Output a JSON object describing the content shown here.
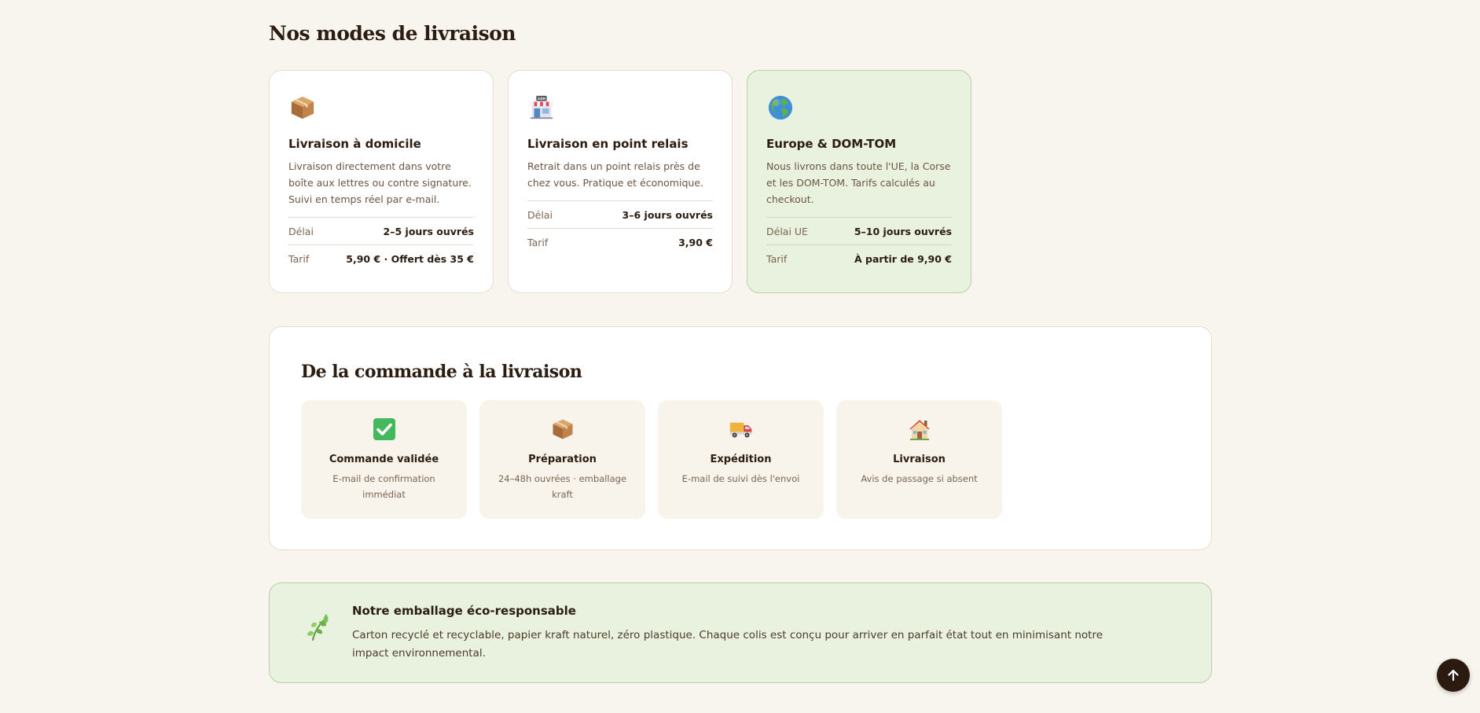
{
  "shipping": {
    "title": "Nos modes de livraison",
    "cards": [
      {
        "icon": "package-icon",
        "title": "Livraison à domicile",
        "description": "Livraison directement dans votre boîte aux lettres ou contre signature. Suivi en temps réel par e-mail.",
        "rows": [
          {
            "label": "Délai",
            "value": "2–5 jours ouvrés"
          },
          {
            "label": "Tarif",
            "value": "5,90 € · Offert dès 35 €"
          }
        ]
      },
      {
        "icon": "store-24h-icon",
        "title": "Livraison en point relais",
        "description": "Retrait dans un point relais près de chez vous. Pratique et économique.",
        "rows": [
          {
            "label": "Délai",
            "value": "3–6 jours ouvrés"
          },
          {
            "label": "Tarif",
            "value": "3,90 €"
          }
        ]
      },
      {
        "icon": "globe-icon",
        "title": "Europe & DOM-TOM",
        "description": "Nous livrons dans toute l'UE, la Corse et les DOM-TOM. Tarifs calculés au checkout.",
        "rows": [
          {
            "label": "Délai UE",
            "value": "5–10 jours ouvrés"
          },
          {
            "label": "Tarif",
            "value": "À partir de 9,90 €"
          }
        ]
      }
    ]
  },
  "process": {
    "title": "De la commande à la livraison",
    "steps": [
      {
        "icon": "check-box-icon",
        "title": "Commande validée",
        "description": "E-mail de confirmation immédiat"
      },
      {
        "icon": "package-icon",
        "title": "Préparation",
        "description": "24–48h ouvrées · emballage kraft"
      },
      {
        "icon": "delivery-truck-icon",
        "title": "Expédition",
        "description": "E-mail de suivi dès l'envoi"
      },
      {
        "icon": "house-icon",
        "title": "Livraison",
        "description": "Avis de passage si absent"
      }
    ]
  },
  "eco": {
    "icon": "leaf-icon",
    "title": "Notre emballage éco-responsable",
    "text": "Carton recyclé et recyclable, papier kraft naturel, zéro plastique. Chaque colis est conçu pour arriver en parfait état tout en minimisant notre impact environnemental."
  },
  "back_to_top": {
    "icon": "arrow-up-icon"
  },
  "colors": {
    "page_background": "#f8f5ef",
    "card_background": "#ffffff",
    "highlight_background": "#e9f2de",
    "highlight_border": "#b7d1a4",
    "text_primary": "#2b1d12",
    "text_muted": "#7a6553",
    "button_dark": "#2b1a10"
  }
}
